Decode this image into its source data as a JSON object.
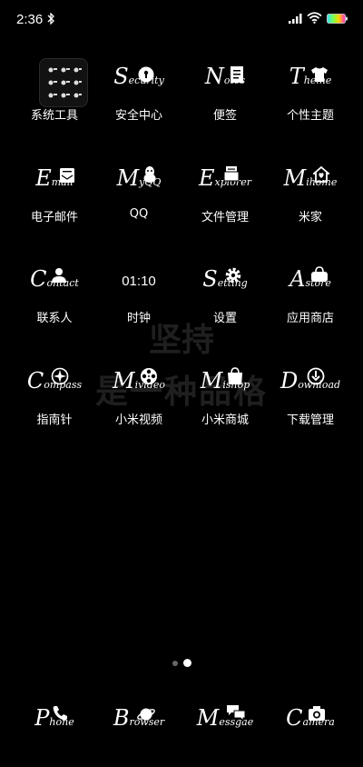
{
  "status": {
    "time": "2:36"
  },
  "watermark": {
    "line1": "坚持",
    "line2": "是一种品格"
  },
  "apps": [
    {
      "label": "系统工具",
      "icon": "folder-icon"
    },
    {
      "label": "安全中心",
      "cap": "S",
      "rest": "ecurity",
      "icon": "shield-icon"
    },
    {
      "label": "便签",
      "cap": "N",
      "rest": "otes",
      "icon": "note-icon"
    },
    {
      "label": "个性主题",
      "cap": "T",
      "rest": "heme",
      "icon": "tshirt-icon"
    },
    {
      "label": "电子邮件",
      "cap": "E",
      "rest": "mail",
      "icon": "mail-icon"
    },
    {
      "label": "QQ",
      "cap": "M",
      "rest": "yQQ",
      "icon": "qq-penguin-icon"
    },
    {
      "label": "文件管理",
      "cap": "E",
      "rest": "xplorer",
      "icon": "folder-file-icon"
    },
    {
      "label": "米家",
      "cap": "M",
      "rest": "ihome",
      "icon": "home-icon"
    },
    {
      "label": "联系人",
      "cap": "C",
      "rest": "ontact",
      "icon": "person-icon"
    },
    {
      "label": "时钟",
      "clock": "01:10",
      "icon": "clock-icon"
    },
    {
      "label": "设置",
      "cap": "S",
      "rest": "etting",
      "icon": "gear-icon"
    },
    {
      "label": "应用商店",
      "cap": "A",
      "rest": "store",
      "icon": "bag-icon"
    },
    {
      "label": "指南针",
      "cap": "C",
      "rest": "ompass",
      "icon": "compass-icon"
    },
    {
      "label": "小米视频",
      "cap": "M",
      "rest": "ivideo",
      "icon": "film-reel-icon"
    },
    {
      "label": "小米商城",
      "cap": "M",
      "rest": "ishop",
      "icon": "shopping-bag-icon"
    },
    {
      "label": "下载管理",
      "cap": "D",
      "rest": "ownload",
      "icon": "download-icon"
    }
  ],
  "dock": [
    {
      "cap": "P",
      "rest": "hone",
      "icon": "phone-icon"
    },
    {
      "cap": "B",
      "rest": "rowser",
      "icon": "planet-icon"
    },
    {
      "cap": "M",
      "rest": "essgae",
      "icon": "chat-bubble-icon"
    },
    {
      "cap": "C",
      "rest": "amera",
      "icon": "camera-icon"
    }
  ],
  "pager": {
    "count": 2,
    "active_index": 1
  }
}
